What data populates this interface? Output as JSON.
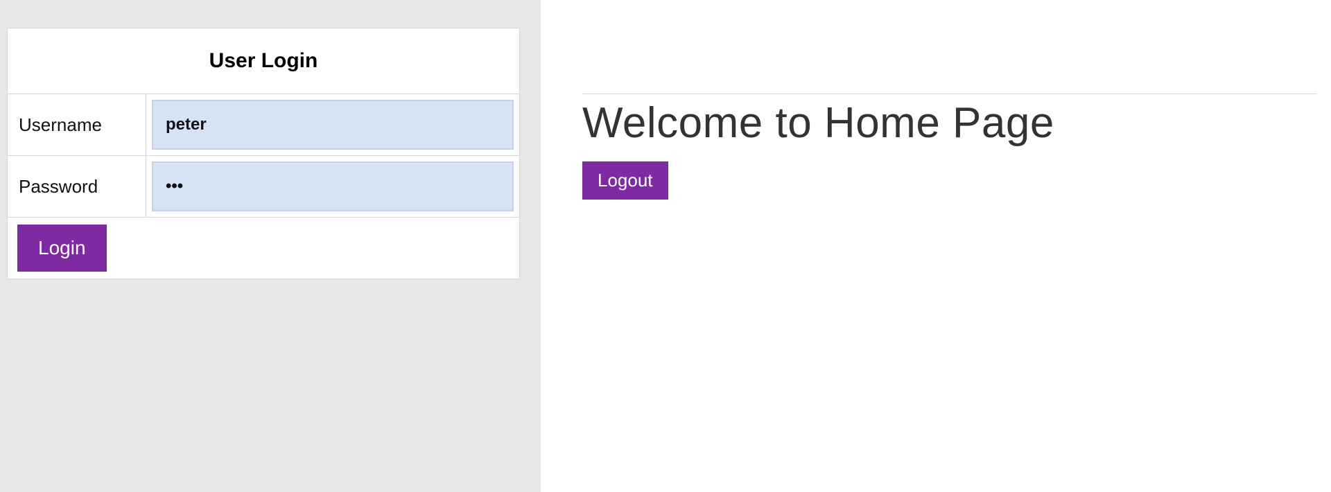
{
  "login": {
    "title": "User Login",
    "username_label": "Username",
    "username_value": "peter",
    "password_label": "Password",
    "password_value": "•••",
    "login_button_label": "Login"
  },
  "home": {
    "heading": "Welcome to Home Page",
    "logout_button_label": "Logout"
  },
  "colors": {
    "accent": "#7e2aa3",
    "input_bg": "#d6e3f5",
    "panel_bg": "#e7e7e7"
  }
}
